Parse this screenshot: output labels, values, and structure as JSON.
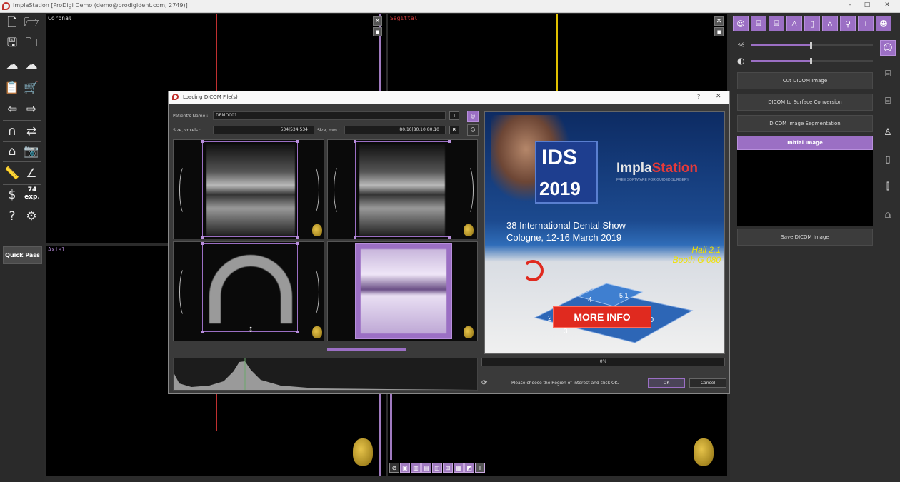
{
  "window": {
    "title": "ImplaStation [ProDigi Demo (demo@prodigident.com, 2749)]",
    "minimize": "–",
    "maximize": "□",
    "close": "✕"
  },
  "left_toolbar": {
    "quick_pass_label": "Quick Pass",
    "exp_count": "74",
    "exp_label": "exp."
  },
  "viewports": {
    "coronal_label": "Coronal",
    "sagittal_label": "Sagittal",
    "axial_label": "Axial"
  },
  "right_panel": {
    "cut_button": "Cut DICOM Image",
    "convert_button": "DICOM to Surface Conversion",
    "segment_button": "DICOM Image Segmentation",
    "initial_image_button": "Initial Image",
    "save_button": "Save DICOM Image",
    "brightness": 0.49,
    "contrast": 0.49
  },
  "modal": {
    "title": "Loading DICOM File(s)",
    "help": "?",
    "close": "✕",
    "patient_label": "Patient's Name :",
    "patient_value": "DEMO001",
    "size_voxels_label": "Size, voxels :",
    "size_voxels_value": "534|534|534",
    "size_mm_label": "Size, mm :",
    "size_mm_value": "80.10|80.10|80.10",
    "i_button": "I",
    "r_button": "R",
    "progress_text": "0%",
    "progress": 0,
    "status_text": "Please choose the Region of Interest and click OK.",
    "ok_label": "OK",
    "cancel_label": "Cancel"
  },
  "ad": {
    "ids": "IDS",
    "year": "2019",
    "brand_a": "Impla",
    "brand_b": "Station",
    "tagline": "FREE SOFTWARE FOR GUIDED SURGERY",
    "show_line1": "38 International Dental Show",
    "show_line2": "Cologne, 12-16 March 2019",
    "hall": "Hall 2.1",
    "booth": "Booth G 080",
    "more_info": "MORE INFO",
    "map_numbers": [
      "2",
      "3",
      "4",
      "5.1",
      "10"
    ]
  },
  "colors": {
    "accent": "#9b6fc4",
    "coronal_line": "#c03030",
    "sagittal_line": "#e0c000",
    "axial_line": "#6aa86a"
  }
}
